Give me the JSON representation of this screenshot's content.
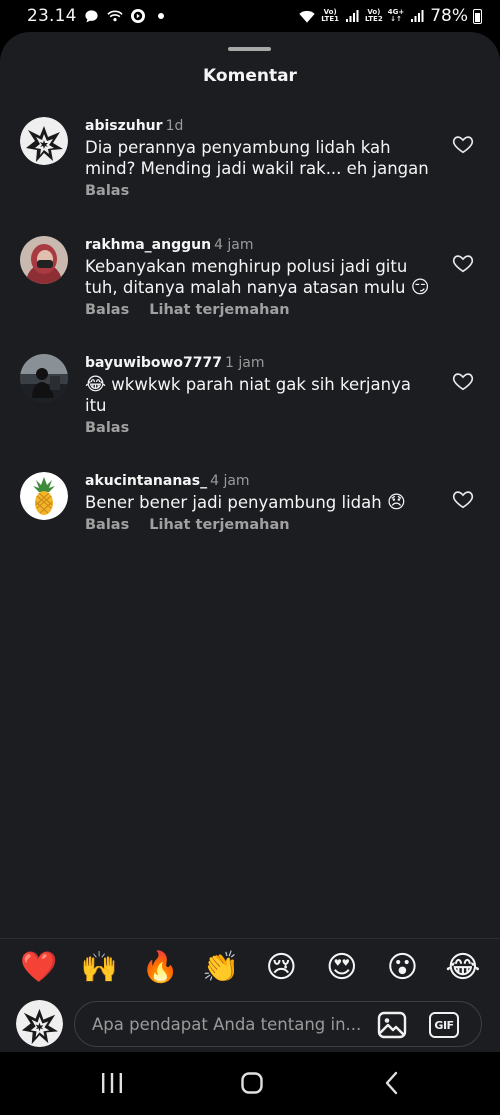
{
  "status_bar": {
    "time": "23.14",
    "sim1_top": "Vo)",
    "sim1_bottom": "LTE1",
    "sim2_top": "Vo)",
    "sim2_bottom": "LTE2",
    "network_type": "4G+",
    "battery": "78%"
  },
  "sheet": {
    "title": "Komentar"
  },
  "comments": [
    {
      "username": "abiszuhur",
      "time": "1d",
      "text": "Dia perannya penyambung lidah kah mind? Mending jadi wakil rak... eh jangan",
      "reply_label": "Balas",
      "avatar": "sketch-face-avatar"
    },
    {
      "username": "rakhma_anggun",
      "time": "4 jam",
      "text": "Kebanyakan menghirup polusi jadi gitu tuh, ditanya malah nanya atasan mulu",
      "emoji": "😏",
      "reply_label": "Balas",
      "translate_label": "Lihat terjemahan",
      "avatar": "masked-person-avatar"
    },
    {
      "username": "bayuwibowo7777",
      "time": "1 jam",
      "emoji": "😂",
      "text": "wkwkwk parah niat gak sih kerjanya itu",
      "reply_label": "Balas",
      "avatar": "person-photo-avatar"
    },
    {
      "username": "akucintananas_",
      "time": "4 jam",
      "text": "Bener bener jadi penyambung lidah",
      "emoji": "😞",
      "reply_label": "Balas",
      "translate_label": "Lihat terjemahan",
      "avatar": "pineapple-avatar"
    }
  ],
  "reactions": [
    "❤️",
    "🙌",
    "🔥",
    "👏",
    "😢",
    "😍",
    "😮",
    "😂"
  ],
  "composer": {
    "placeholder": "Apa pendapat Anda tentang in...",
    "gif_label": "GIF"
  },
  "colors": {
    "sheet_background": "#1b1d21",
    "text_primary": "#f5f5f5",
    "text_secondary": "#9a9a9a"
  }
}
